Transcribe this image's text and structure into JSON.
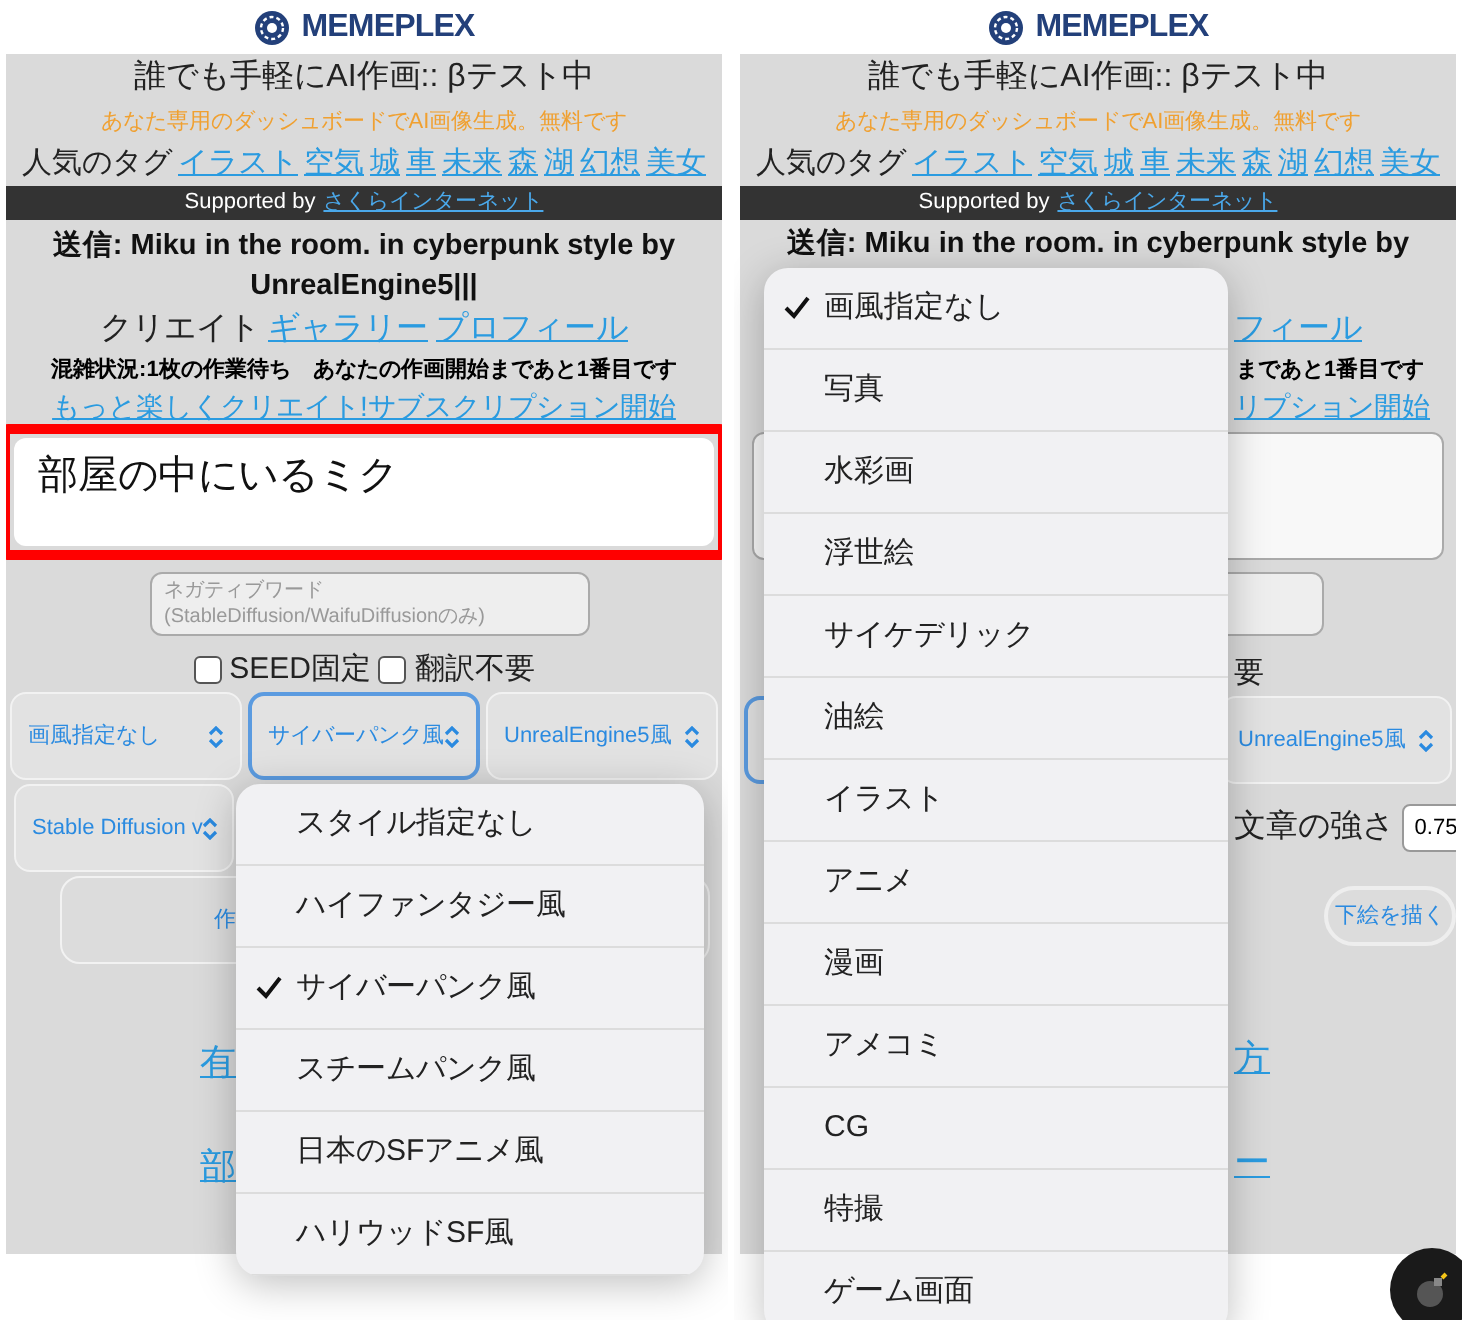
{
  "screens": [
    {
      "kind": "style_menu",
      "header": {
        "brand": "MEMEPLEX"
      },
      "headline": "誰でも手軽にAI作画:: βテスト中",
      "tagline": "あなた専用のダッシュボードでAI画像生成。無料です",
      "tags": {
        "label": "人気のタグ",
        "items": [
          "イラスト",
          "空気",
          "城",
          "車",
          "未来",
          "森",
          "湖",
          "幻想",
          "美女"
        ]
      },
      "sponsor": {
        "text": "Supported by",
        "link": "さくらインターネット"
      },
      "sent": "送信: Miku in the room. in cyberpunk style by UnrealEngine5|||",
      "creator": {
        "label": "クリエイト",
        "links": [
          "ギャラリー",
          "プロフィール"
        ]
      },
      "queue": "混雑状況:1枚の作業待ち　あなたの作画開始まであと1番目です",
      "subscribe_link": "もっと楽しくクリエイト!サブスクリプション開始",
      "prompt": {
        "value": "部屋の中にいるミク",
        "highlighted": true
      },
      "negative": {
        "placeholder": "ネガティブワード\n(StableDiffusion/WaifuDiffusionのみ)"
      },
      "options": [
        {
          "label": "SEED固定",
          "checked": false
        },
        {
          "label": "翻訳不要",
          "checked": false
        }
      ],
      "selects": [
        {
          "value": "画風指定なし",
          "focused": false
        },
        {
          "value": "サイバーパンク風",
          "focused": true
        },
        {
          "value": "UnrealEngine5風",
          "focused": false
        }
      ],
      "model_select": {
        "value": "Stable Diffusion v"
      },
      "generate_button": "作",
      "links": [
        "有",
        "部"
      ],
      "menu": {
        "items": [
          {
            "label": "スタイル指定なし",
            "selected": false
          },
          {
            "label": "ハイファンタジー風",
            "selected": false
          },
          {
            "label": "サイバーパンク風",
            "selected": true
          },
          {
            "label": "スチームパンク風",
            "selected": false
          },
          {
            "label": "日本のSFアニメ風",
            "selected": false
          },
          {
            "label": "ハリウッドSF風",
            "selected": false
          }
        ]
      }
    },
    {
      "kind": "art_menu",
      "header": {
        "brand": "MEMEPLEX"
      },
      "headline": "誰でも手軽にAI作画:: βテスト中",
      "tagline": "あなた専用のダッシュボードでAI画像生成。無料です",
      "tags": {
        "label": "人気のタグ",
        "items": [
          "イラスト",
          "空気",
          "城",
          "車",
          "未来",
          "森",
          "湖",
          "幻想",
          "美女"
        ]
      },
      "sponsor": {
        "text": "Supported by",
        "link": "さくらインターネット"
      },
      "sent": "送信: Miku in the room. in cyberpunk style by",
      "creator_link": "フィール",
      "queue": "まであと1番目です",
      "subscribe_link": "リプション開始",
      "option_label": "要",
      "selects": [
        {
          "focused": true
        },
        {
          "value": "UnrealEngine5風",
          "focused": false
        }
      ],
      "strength": {
        "label": "文章の強さ",
        "value": "0.75"
      },
      "sketch_button": "下絵を描く",
      "links": [
        "方",
        "ー"
      ],
      "menu": {
        "items": [
          {
            "label": "画風指定なし",
            "selected": true
          },
          {
            "label": "写真",
            "selected": false
          },
          {
            "label": "水彩画",
            "selected": false
          },
          {
            "label": "浮世絵",
            "selected": false
          },
          {
            "label": "サイケデリック",
            "selected": false
          },
          {
            "label": "油絵",
            "selected": false
          },
          {
            "label": "イラスト",
            "selected": false
          },
          {
            "label": "アニメ",
            "selected": false
          },
          {
            "label": "漫画",
            "selected": false
          },
          {
            "label": "アメコミ",
            "selected": false
          },
          {
            "label": "CG",
            "selected": false
          },
          {
            "label": "特撮",
            "selected": false
          },
          {
            "label": "ゲーム画面",
            "selected": false
          }
        ]
      }
    }
  ]
}
